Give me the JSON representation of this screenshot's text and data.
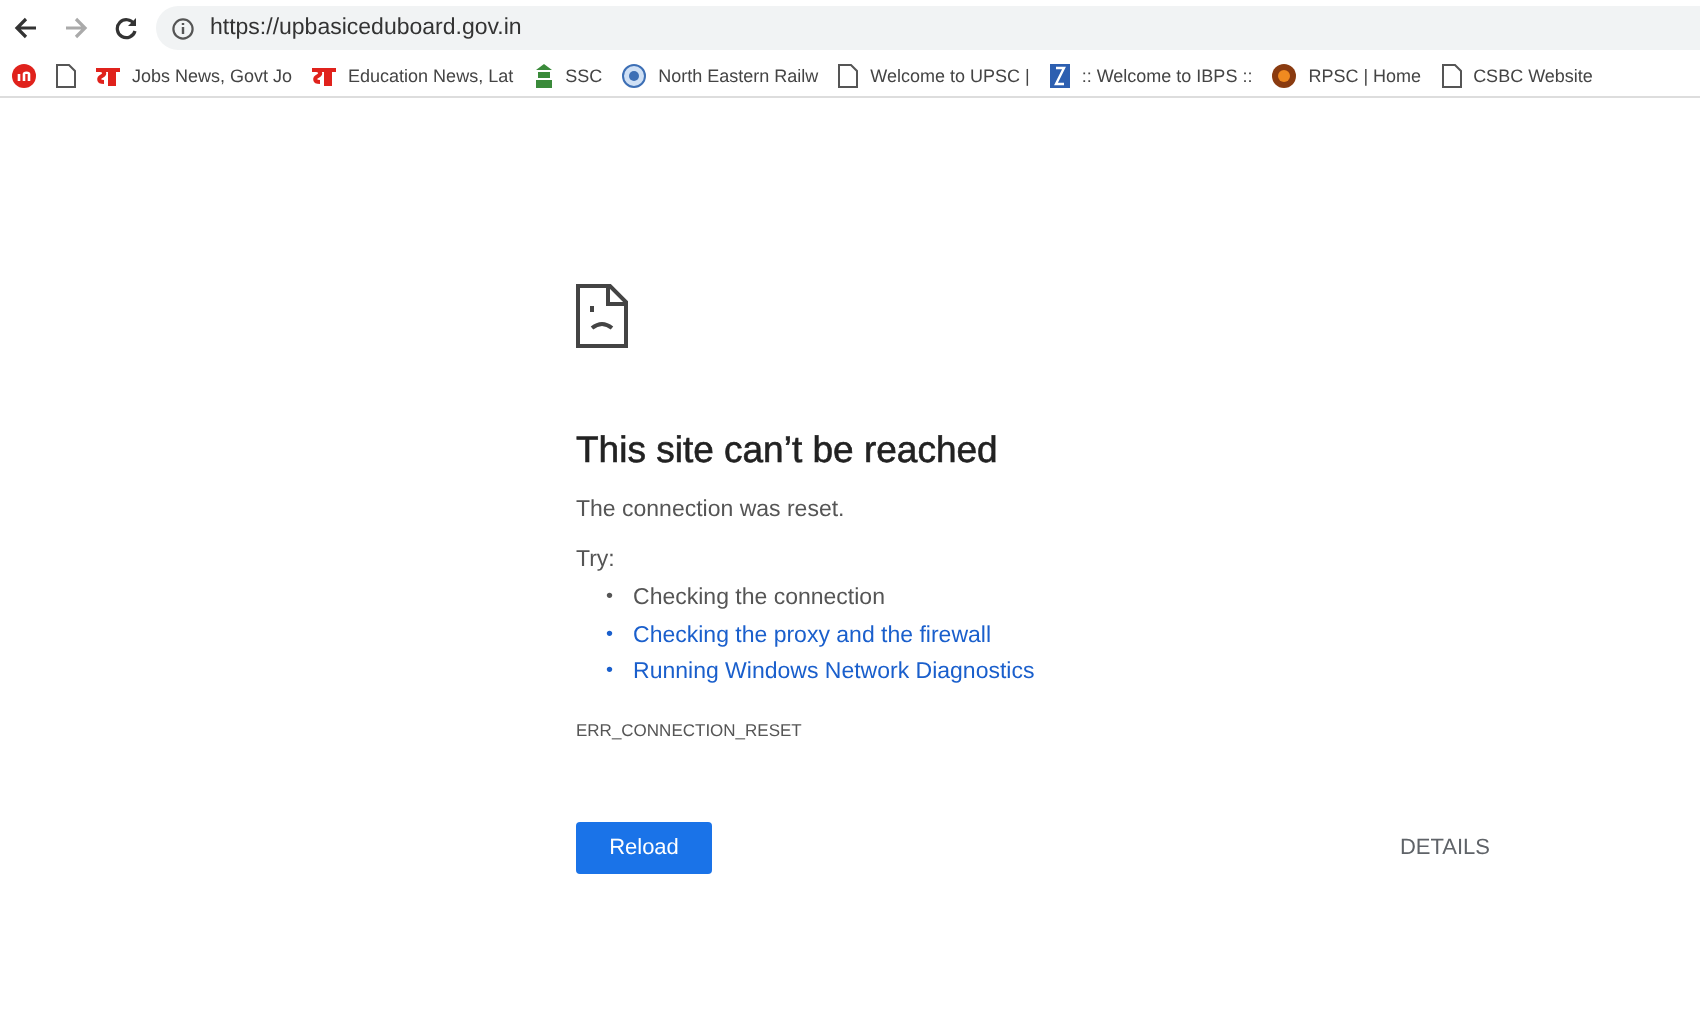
{
  "toolbar": {
    "url": "https://upbasiceduboard.gov.in"
  },
  "bookmarks": [
    {
      "kind": "red-circle"
    },
    {
      "kind": "page"
    },
    {
      "kind": "red-letter",
      "label": "Jobs News, Govt Jo"
    },
    {
      "kind": "red-letter",
      "label": "Education News, Lat"
    },
    {
      "kind": "green-emblem",
      "label": "SSC"
    },
    {
      "kind": "blue-globe",
      "label": "North Eastern Railw"
    },
    {
      "kind": "page",
      "label": "Welcome to UPSC |"
    },
    {
      "kind": "blue-emblem",
      "label": ":: Welcome to IBPS ::"
    },
    {
      "kind": "orange-seal",
      "label": "RPSC | Home"
    },
    {
      "kind": "page",
      "label": "CSBC Website"
    }
  ],
  "error": {
    "title": "This site can’t be reached",
    "message": "The connection was reset.",
    "try_label": "Try:",
    "suggestions": [
      {
        "bullet": "•",
        "text": "Checking the connection",
        "link": false
      },
      {
        "bullet": "•",
        "text": "Checking the proxy and the firewall",
        "link": true
      },
      {
        "bullet": "•",
        "text": "Running Windows Network Diagnostics",
        "link": true
      }
    ],
    "code": "ERR_CONNECTION_RESET",
    "reload": "Reload",
    "details": "DETAILS"
  }
}
